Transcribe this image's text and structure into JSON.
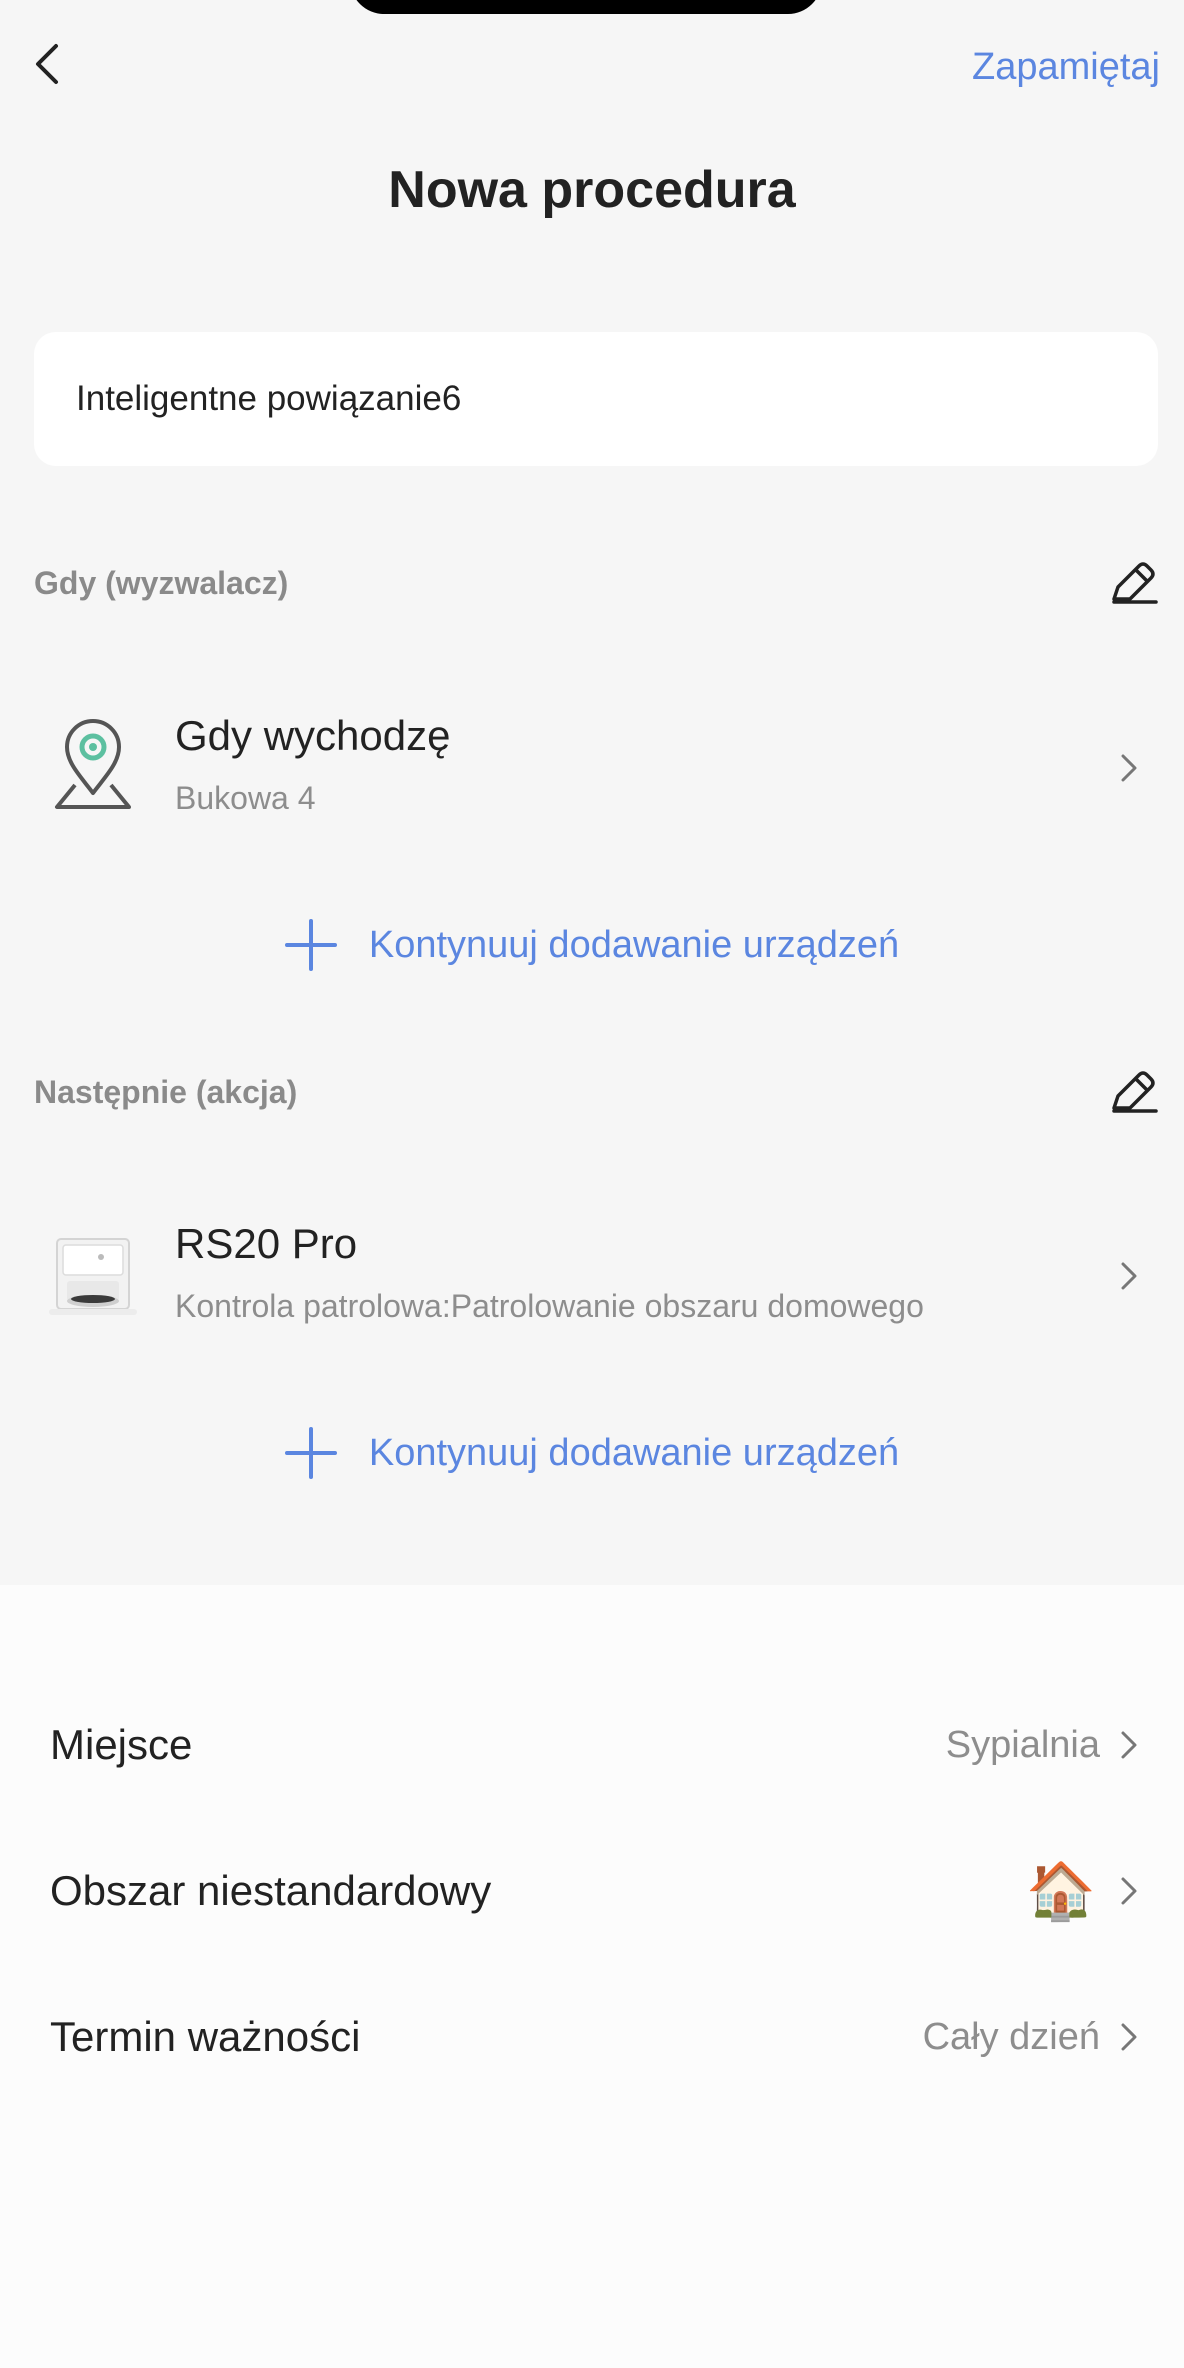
{
  "header": {
    "save_label": "Zapamiętaj",
    "title": "Nowa procedura"
  },
  "name_field": {
    "value": "Inteligentne powiązanie6"
  },
  "trigger_section": {
    "label": "Gdy (wyzwalacz)",
    "item": {
      "title": "Gdy wychodzę",
      "subtitle": "Bukowa 4",
      "icon": "location-pin-icon"
    },
    "add_label": "Kontynuuj dodawanie urządzeń"
  },
  "action_section": {
    "label": "Następnie (akcja)",
    "item": {
      "title": "RS20 Pro",
      "subtitle": "Kontrola patrolowa:Patrolowanie obszaru domowego",
      "icon": "robot-vacuum-icon"
    },
    "add_label": "Kontynuuj dodawanie urządzeń"
  },
  "settings": {
    "place": {
      "label": "Miejsce",
      "value": "Sypialnia"
    },
    "custom_area": {
      "label": "Obszar niestandardowy",
      "value_icon": "house-emoji-icon",
      "emoji": "🏠"
    },
    "validity": {
      "label": "Termin ważności",
      "value": "Cały dzień"
    }
  },
  "colors": {
    "accent": "#5b86e0",
    "background": "#f6f6f6",
    "card": "#ffffff",
    "pin_green": "#5cc0a0"
  }
}
